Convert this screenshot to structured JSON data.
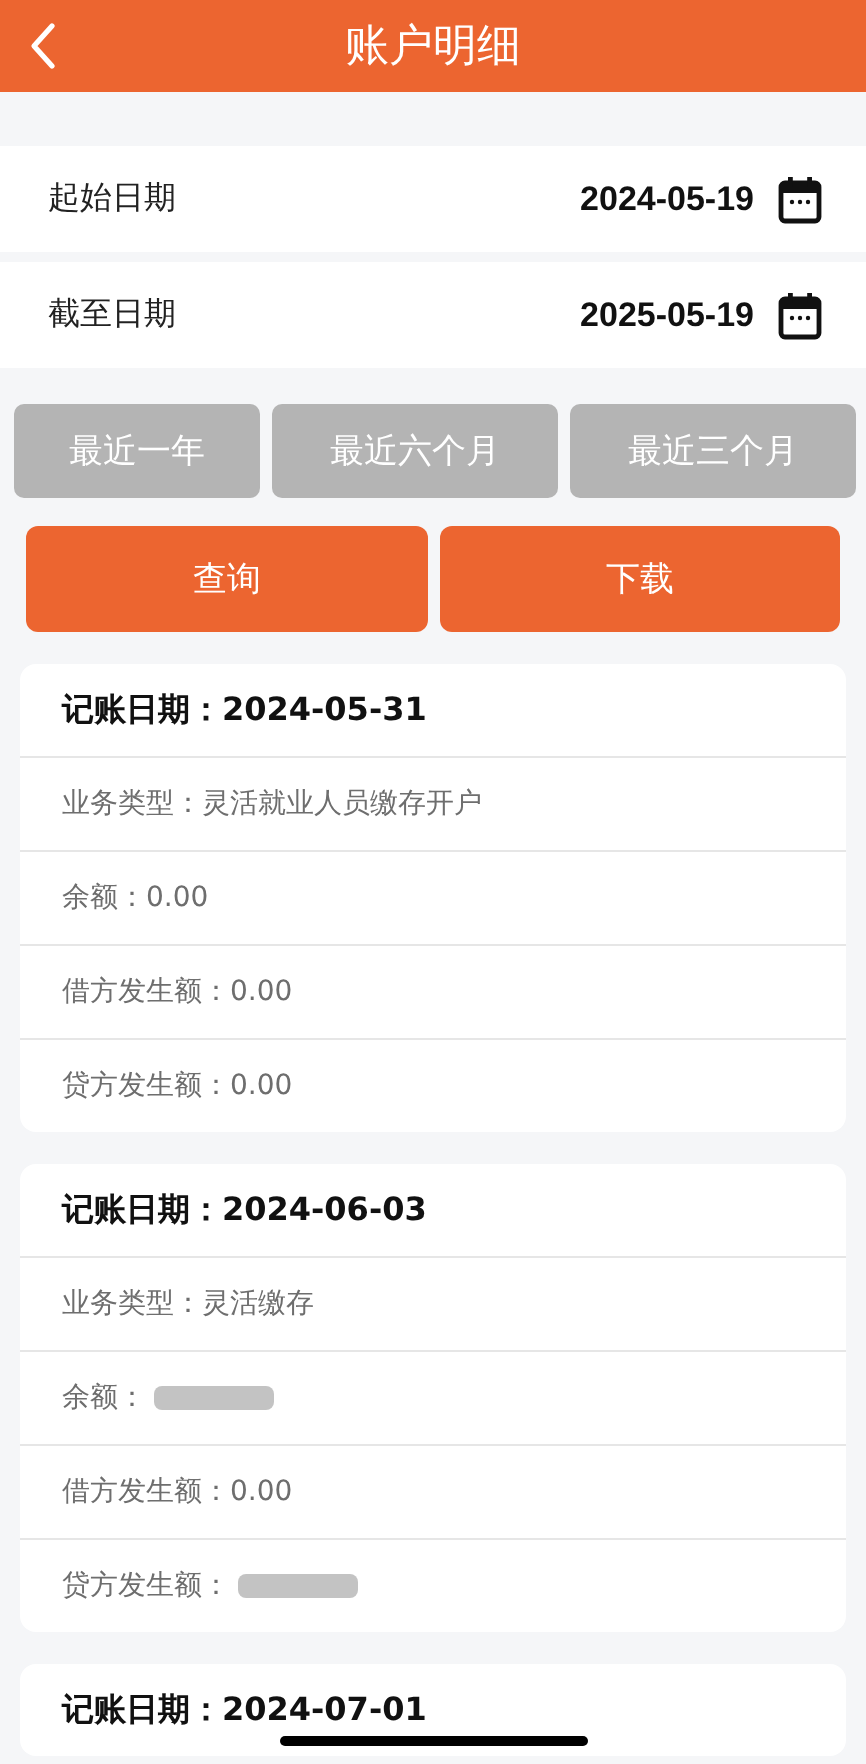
{
  "header": {
    "title": "账户明细"
  },
  "date_fields": [
    {
      "label": "起始日期",
      "value": "2024-05-19"
    },
    {
      "label": "截至日期",
      "value": "2025-05-19"
    }
  ],
  "presets": [
    {
      "label": "最近一年",
      "selected": false
    },
    {
      "label": "最近六个月",
      "selected": false
    },
    {
      "label": "最近三个月",
      "selected": false
    }
  ],
  "actions": [
    "查询",
    "下载"
  ],
  "records": [
    {
      "date_label": "记账日期：",
      "date": "2024-05-31",
      "fields": [
        {
          "label": "业务类型：",
          "value": "灵活就业人员缴存开户",
          "redacted": false
        },
        {
          "label": "余额：",
          "value": "0.00",
          "redacted": false
        },
        {
          "label": "借方发生额：",
          "value": "0.00",
          "redacted": false
        },
        {
          "label": "贷方发生额：",
          "value": "0.00",
          "redacted": false
        }
      ]
    },
    {
      "date_label": "记账日期：",
      "date": "2024-06-03",
      "fields": [
        {
          "label": "业务类型：",
          "value": "灵活缴存",
          "redacted": false
        },
        {
          "label": "余额：",
          "redacted": true
        },
        {
          "label": "借方发生额：",
          "value": "0.00",
          "redacted": false
        },
        {
          "label": "贷方发生额：",
          "redacted": true
        }
      ]
    },
    {
      "date_label": "记账日期：",
      "date": "2024-07-01"
    }
  ]
}
